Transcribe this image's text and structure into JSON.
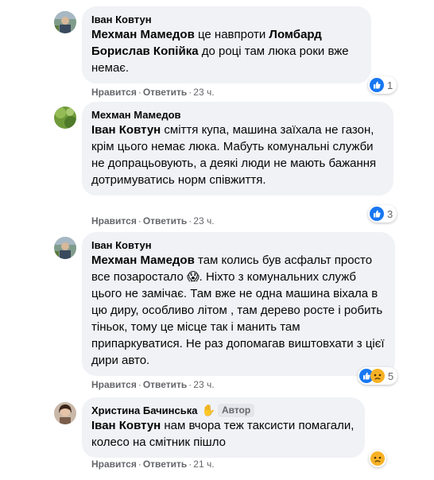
{
  "comments": [
    {
      "author": "Іван Ковтун",
      "mention": "Мехман Мамедов",
      "text_1": " це навпроти ",
      "bold_2": "Ломбард Борислав Копійка",
      "text_2": " до році там люка роки вже немає.",
      "like_label": "Нравится",
      "reply_label": "Ответить",
      "time": "23 ч.",
      "reaction_count": "1"
    },
    {
      "author": "Мехман Мамедов",
      "mention": "Іван Ковтун",
      "text_1": " сміття купа, машина заїхала не газон, крім цього немає люка. Мабуть комунальні служби не допрацьовують, а деякі люди не мають бажання дотримуватись норм співжиття.",
      "like_label": "Нравится",
      "reply_label": "Ответить",
      "time": "23 ч.",
      "reaction_count": "3"
    },
    {
      "author": "Іван Ковтун",
      "mention": "Мехман Мамедов",
      "text_1": " там колись був асфальт просто все позаростало ",
      "emoji": "😱",
      "text_2": ". Ніхто з комунальних служб цього не замічає. Там вже не одна машина віхала в цю диру, особливо літом , там дерево росте і робить тіньок, тому це місце так і манить там припаркуватися. Не раз допомагав виштовхати з цієї дири авто.",
      "like_label": "Нравится",
      "reply_label": "Ответить",
      "time": "23 ч.",
      "reaction_count": "5"
    },
    {
      "author": "Христина Бачинська",
      "author_badge": "Автор",
      "mention": "Іван Ковтун",
      "text_1": " нам вчора теж таксисти помагали, колесо на смітник пішло",
      "like_label": "Нравится",
      "reply_label": "Ответить",
      "time": "21 ч."
    }
  ],
  "icons": {
    "like": "like-icon",
    "sad": "sad-icon",
    "wave": "wave-icon"
  },
  "colors": {
    "bubble_bg": "#f0f2f5",
    "like_blue": "#1877f2",
    "sad_yellow": "#f7b125",
    "meta_gray": "#65676b"
  }
}
